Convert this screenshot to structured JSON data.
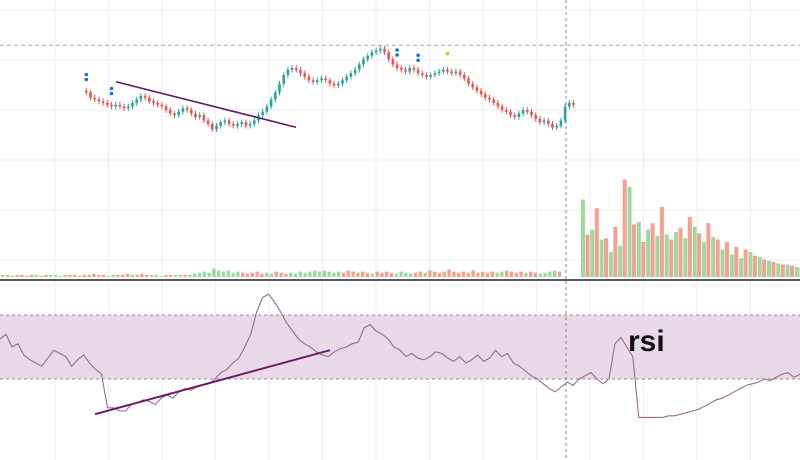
{
  "chart_data": [
    {
      "type": "candlestick",
      "panel": "price",
      "title": "",
      "xlabel": "",
      "ylabel": "",
      "grid": true,
      "colors": {
        "up": "#26a69a",
        "down": "#ef5350",
        "volume_up": "#9ed9a2",
        "volume_down": "#f5a091",
        "trendline": "#6b1a6e",
        "crosshair": "#888888",
        "marker_blue": "#1e6bd6",
        "marker_yellow": "#f2b807"
      },
      "ylim": [
        0,
        100
      ],
      "closes": [
        70,
        67,
        66,
        65,
        64,
        63,
        62,
        63,
        62,
        61,
        62,
        64,
        66,
        68,
        67,
        65,
        64,
        63,
        62,
        60,
        58,
        57,
        59,
        61,
        60,
        58,
        56,
        57,
        54,
        52,
        49,
        51,
        53,
        54,
        52,
        51,
        52,
        53,
        51,
        52,
        54,
        57,
        59,
        62,
        66,
        70,
        75,
        80,
        83,
        84,
        83,
        81,
        79,
        77,
        76,
        77,
        78,
        77,
        75,
        74,
        75,
        77,
        79,
        81,
        83,
        86,
        89,
        91,
        93,
        94,
        95,
        93,
        89,
        86,
        84,
        83,
        82,
        84,
        83,
        81,
        80,
        79,
        80,
        81,
        82,
        83,
        82,
        81,
        82,
        80,
        78,
        75,
        73,
        71,
        69,
        67,
        66,
        64,
        62,
        60,
        59,
        57,
        56,
        58,
        60,
        59,
        57,
        55,
        53,
        54,
        52,
        50,
        51,
        54,
        62,
        64,
        63
      ],
      "volumes": [
        0.02,
        0.02,
        0.01,
        0.02,
        0.02,
        0.01,
        0.02,
        0.02,
        0.01,
        0.02,
        0.02,
        0.02,
        0.01,
        0.02,
        0.02,
        0.02,
        0.01,
        0.02,
        0.02,
        0.03,
        0.02,
        0.02,
        0.01,
        0.02,
        0.02,
        0.02,
        0.03,
        0.02,
        0.02,
        0.03,
        0.02,
        0.02,
        0.02,
        0.01,
        0.02,
        0.02,
        0.02,
        0.02,
        0.02,
        0.02,
        0.03,
        0.04,
        0.05,
        0.04,
        0.08,
        0.06,
        0.05,
        0.06,
        0.04,
        0.05,
        0.04,
        0.03,
        0.04,
        0.05,
        0.03,
        0.04,
        0.03,
        0.05,
        0.04,
        0.03,
        0.04,
        0.03,
        0.05,
        0.04,
        0.05,
        0.06,
        0.05,
        0.06,
        0.05,
        0.04,
        0.05,
        0.04,
        0.06,
        0.05,
        0.04,
        0.05,
        0.04,
        0.03,
        0.05,
        0.04,
        0.05,
        0.04,
        0.03,
        0.05,
        0.04,
        0.03,
        0.04,
        0.05,
        0.04,
        0.06,
        0.05,
        0.04,
        0.05,
        0.07,
        0.05,
        0.04,
        0.05,
        0.04,
        0.06,
        0.04,
        0.05,
        0.04,
        0.05,
        0.04,
        0.05,
        0.06,
        0.05,
        0.04,
        0.05,
        0.04,
        0.05,
        0.04,
        0.03,
        0.04,
        0.05,
        0.06,
        0.05
      ],
      "markers": [
        {
          "i": 0,
          "color": "blue"
        },
        {
          "i": 6,
          "color": "blue"
        },
        {
          "i": 74,
          "color": "blue"
        },
        {
          "i": 79,
          "color": "blue"
        },
        {
          "i": 86,
          "color": "yellow"
        }
      ],
      "trendline": {
        "from": {
          "i": 5,
          "price": 75
        },
        "to": {
          "i": 35,
          "price": 57
        }
      },
      "forecast": {
        "volumes_up": [
          0.62,
          0.38,
          0.3,
          0.2,
          0.25,
          0.72,
          0.44,
          0.38,
          0.33,
          0.34,
          0.36,
          0.31,
          0.4,
          0.28,
          0.32,
          0.22,
          0.18,
          0.15,
          0.2,
          0.16,
          0.13,
          0.11,
          0.1,
          0.08
        ],
        "volumes_down": [
          0.34,
          0.55,
          0.31,
          0.4,
          0.78,
          0.42,
          0.28,
          0.43,
          0.56,
          0.3,
          0.39,
          0.48,
          0.35,
          0.43,
          0.3,
          0.28,
          0.24,
          0.22,
          0.17,
          0.14,
          0.12,
          0.1,
          0.09,
          0.07
        ]
      },
      "reference_level": 97
    },
    {
      "type": "line",
      "panel": "rsi",
      "title": "rsi",
      "ylim": [
        0,
        100
      ],
      "band": [
        30,
        70
      ],
      "values": [
        55,
        58,
        50,
        52,
        45,
        42,
        40,
        38,
        43,
        48,
        46,
        44,
        38,
        42,
        45,
        40,
        36,
        33,
        12,
        12,
        10,
        10,
        14,
        15,
        17,
        16,
        14,
        18,
        20,
        18,
        22,
        24,
        23,
        25,
        26,
        27,
        30,
        34,
        36,
        40,
        43,
        50,
        58,
        72,
        81,
        83,
        78,
        72,
        65,
        60,
        55,
        52,
        50,
        47,
        45,
        44,
        47,
        49,
        50,
        52,
        53,
        62,
        64,
        60,
        58,
        55,
        50,
        48,
        44,
        46,
        43,
        42,
        44,
        47,
        46,
        43,
        41,
        44,
        40,
        42,
        45,
        41,
        43,
        48,
        44,
        46,
        40,
        38,
        35,
        32,
        30,
        27,
        24,
        22,
        25,
        28,
        26,
        30,
        32,
        34,
        30,
        27,
        30,
        52,
        56,
        50,
        44,
        6,
        6,
        6,
        6,
        6,
        7,
        7,
        8,
        9,
        10,
        11,
        13,
        15,
        17,
        18,
        20,
        22,
        24,
        26,
        27,
        28,
        30,
        29,
        31,
        33,
        34,
        31,
        33
      ]
    }
  ],
  "labels": {
    "rsi": "rsi"
  }
}
